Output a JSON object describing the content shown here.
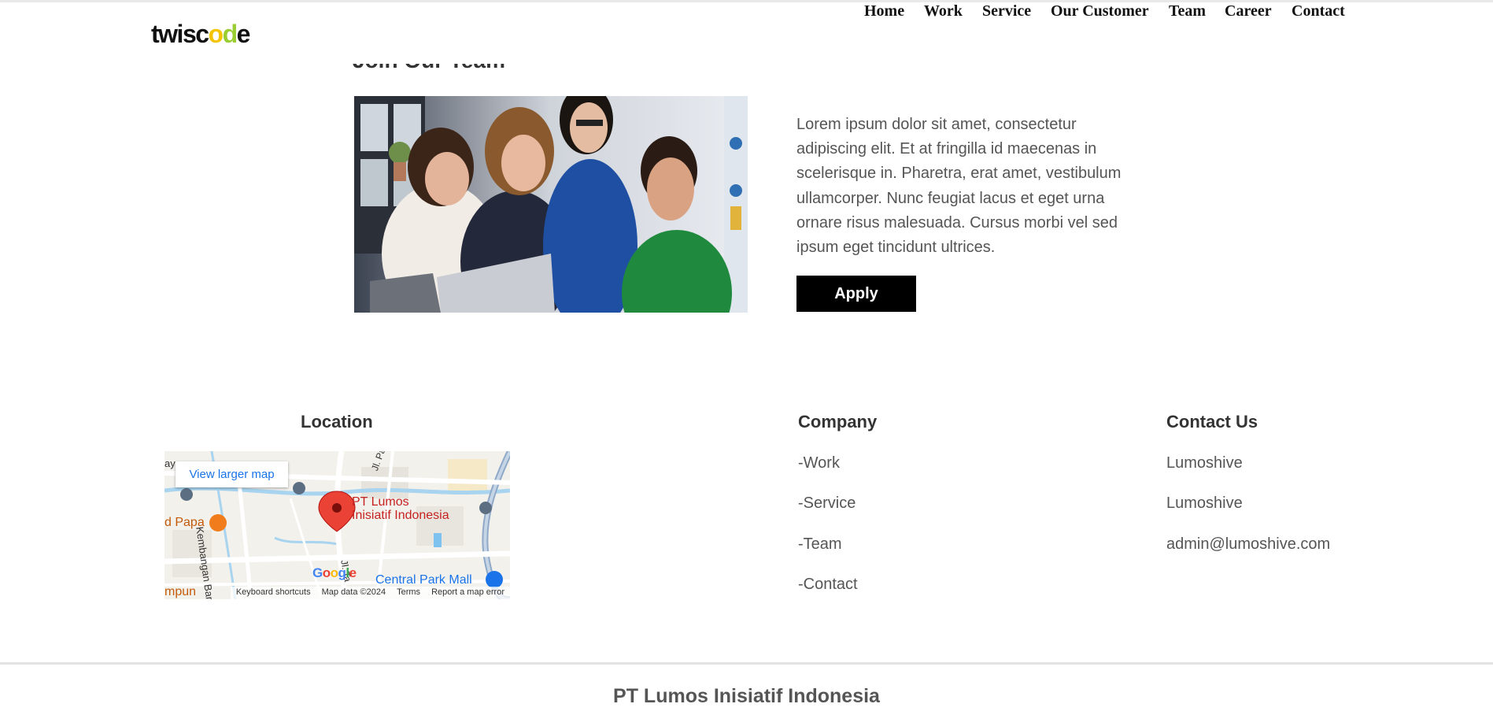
{
  "header": {
    "logo": {
      "text_main": "twisc",
      "text_accent1": "o",
      "text_accent2": "d",
      "text_end": "e",
      "colors": {
        "main": "#111111",
        "accent1": "#f5c400",
        "accent2": "#9acd32"
      }
    },
    "nav": [
      "Home",
      "Work",
      "Service",
      "Our Customer",
      "Team",
      "Career",
      "Contact"
    ]
  },
  "join": {
    "title": "Join Our Team",
    "description": "Lorem ipsum dolor sit amet, consectetur adipiscing elit. Et at fringilla id maecenas in scelerisque in. Pharetra, erat amet, vestibulum ullamcorper. Nunc feugiat lacus et eget urna ornare risus malesuada. Cursus morbi vel sed ipsum eget tincidunt ultrices.",
    "apply_label": "Apply",
    "photo_icon": "team-photo"
  },
  "location": {
    "title": "Location",
    "map": {
      "view_larger": "View larger map",
      "place_name_line1": "PT Lumos",
      "place_name_line2": "Inisiatif Indonesia",
      "poi_left": "d Papa",
      "poi_right": "Central Park Mall",
      "street_1": "Kembangan Baru",
      "street_2": "Jl. Pa",
      "street_3": "Jl. Ta",
      "corner_left": "ay",
      "corner_bottom": "mpun",
      "google": "Google",
      "attribution": [
        "Keyboard shortcuts",
        "Map data ©2024",
        "Terms",
        "Report a map error"
      ],
      "pin_color": "#ea4335"
    }
  },
  "company": {
    "title": "Company",
    "links": [
      "-Work",
      "-Service",
      "-Team",
      "-Contact"
    ]
  },
  "contact": {
    "title": "Contact Us",
    "lines": [
      "Lumoshive",
      "Lumoshive",
      "admin@lumoshive.com"
    ]
  },
  "footer": {
    "copyright": "PT Lumos Inisiatif Indonesia"
  }
}
